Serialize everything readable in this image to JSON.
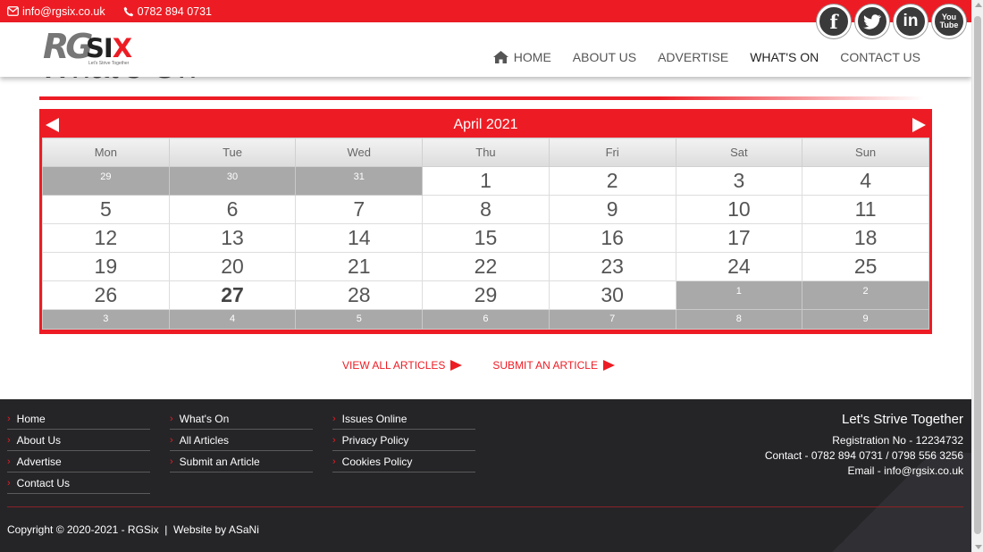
{
  "topbar": {
    "email": "info@rgsix.co.uk",
    "phone": "0782 894 0731"
  },
  "logo": {
    "main": "RG",
    "six": "SI",
    "x": "X",
    "tagline": "Let's Strive Together"
  },
  "social": [
    {
      "icon": "facebook-icon",
      "label": "f"
    },
    {
      "icon": "twitter-icon",
      "label": "t"
    },
    {
      "icon": "linkedin-icon",
      "label": "in"
    },
    {
      "icon": "youtube-icon",
      "label": "You Tube"
    }
  ],
  "nav": {
    "home": "HOME",
    "about": "ABOUT US",
    "advertise": "ADVERTISE",
    "whats_on": "WHAT'S ON",
    "contact": "CONTACT US"
  },
  "page": {
    "title": "What's On"
  },
  "calendar": {
    "month": "April 2021",
    "days": [
      "Mon",
      "Tue",
      "Wed",
      "Thu",
      "Fri",
      "Sat",
      "Sun"
    ],
    "weeks": [
      [
        {
          "d": "29",
          "o": true
        },
        {
          "d": "30",
          "o": true
        },
        {
          "d": "31",
          "o": true
        },
        {
          "d": "1"
        },
        {
          "d": "2"
        },
        {
          "d": "3"
        },
        {
          "d": "4"
        }
      ],
      [
        {
          "d": "5"
        },
        {
          "d": "6"
        },
        {
          "d": "7"
        },
        {
          "d": "8"
        },
        {
          "d": "9"
        },
        {
          "d": "10"
        },
        {
          "d": "11"
        }
      ],
      [
        {
          "d": "12"
        },
        {
          "d": "13"
        },
        {
          "d": "14"
        },
        {
          "d": "15"
        },
        {
          "d": "16"
        },
        {
          "d": "17"
        },
        {
          "d": "18"
        }
      ],
      [
        {
          "d": "19"
        },
        {
          "d": "20"
        },
        {
          "d": "21"
        },
        {
          "d": "22"
        },
        {
          "d": "23"
        },
        {
          "d": "24"
        },
        {
          "d": "25"
        }
      ],
      [
        {
          "d": "26"
        },
        {
          "d": "27",
          "today": true
        },
        {
          "d": "28"
        },
        {
          "d": "29"
        },
        {
          "d": "30"
        },
        {
          "d": "1",
          "o": true
        },
        {
          "d": "2",
          "o": true
        }
      ],
      [
        {
          "d": "3",
          "o": true
        },
        {
          "d": "4",
          "o": true
        },
        {
          "d": "5",
          "o": true
        },
        {
          "d": "6",
          "o": true
        },
        {
          "d": "7",
          "o": true
        },
        {
          "d": "8",
          "o": true
        },
        {
          "d": "9",
          "o": true
        }
      ]
    ]
  },
  "actions": {
    "view_all": "VIEW ALL ARTICLES",
    "submit": "SUBMIT AN ARTICLE"
  },
  "footer": {
    "col1": [
      "Home",
      "About Us",
      "Advertise",
      "Contact Us"
    ],
    "col2": [
      "What's On",
      "All Articles",
      "Submit an Article"
    ],
    "col3": [
      "Issues Online",
      "Privacy Policy",
      "Cookies Policy"
    ],
    "tagline": "Let's Strive Together",
    "registration": "Registration No - 12234732",
    "contact": "Contact - 0782 894 0731 / 0798 556 3256",
    "email": "Email - info@rgsix.co.uk",
    "copyright": "Copyright © 2020-2021 - RGSix  |  Website by ASaNi"
  },
  "colors": {
    "accent": "#ed1c24",
    "footer_bg": "#252528",
    "other_month": "#a9a9a9"
  }
}
